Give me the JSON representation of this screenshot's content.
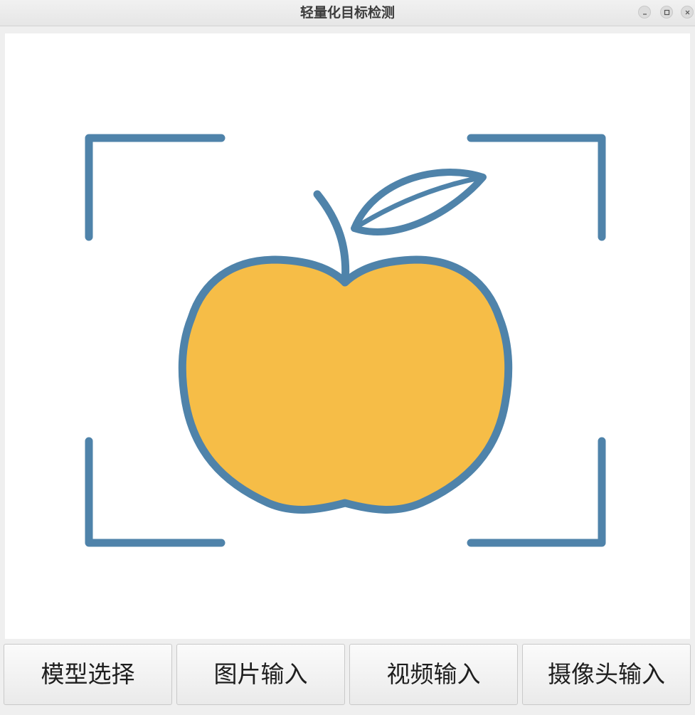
{
  "window": {
    "title": "轻量化目标检测",
    "controls": [
      "minimize-icon",
      "maximize-icon",
      "close-icon"
    ]
  },
  "display": {
    "image_icon": "apple-detection-icon",
    "colors": {
      "stroke": "#4f83aa",
      "apple_fill": "#f6bd47",
      "background": "#ffffff"
    }
  },
  "buttons": {
    "model_select": "模型选择",
    "image_input": "图片输入",
    "video_input": "视频输入",
    "camera_input": "摄像头输入"
  }
}
